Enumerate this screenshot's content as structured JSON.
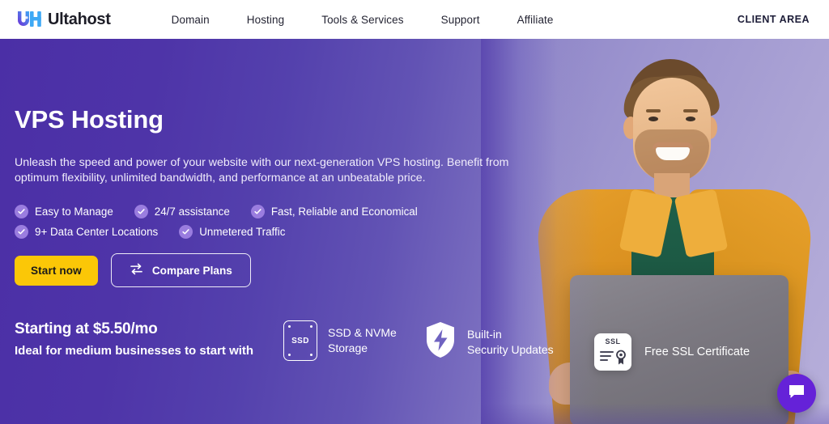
{
  "header": {
    "brand": {
      "name": "Ultahost",
      "logo_icon": "ultahost-uh-logo-icon"
    },
    "nav": [
      {
        "label": "Domain"
      },
      {
        "label": "Hosting"
      },
      {
        "label": "Tools & Services"
      },
      {
        "label": "Support"
      },
      {
        "label": "Affiliate"
      }
    ],
    "client_area": "CLIENT AREA"
  },
  "hero": {
    "title": "VPS Hosting",
    "subtitle": "Unleash the speed and power of your website with our next-generation VPS hosting. Benefit from optimum flexibility, unlimited bandwidth, and performance at an unbeatable price.",
    "features_row1": [
      {
        "label": "Easy to Manage",
        "icon": "check-circle-icon"
      },
      {
        "label": "24/7 assistance",
        "icon": "check-circle-icon"
      },
      {
        "label": "Fast, Reliable and Economical",
        "icon": "check-circle-icon"
      }
    ],
    "features_row2": [
      {
        "label": "9+ Data Center Locations",
        "icon": "check-circle-icon"
      },
      {
        "label": "Unmetered Traffic",
        "icon": "check-circle-icon"
      }
    ],
    "cta_primary": "Start now",
    "cta_secondary": "Compare Plans",
    "cta_secondary_icon": "compare-swap-arrows-icon"
  },
  "strip": {
    "price_headline": "Starting at $5.50/mo",
    "price_sub": "Ideal for medium businesses to start with",
    "perks": [
      {
        "label": "SSD & NVMe\nStorage",
        "icon": "ssd-drive-icon",
        "icon_text": "SSD"
      },
      {
        "label": "Built-in\nSecurity Updates",
        "icon": "shield-bolt-icon"
      }
    ],
    "ssl_badge": {
      "label": "Free SSL Certificate",
      "icon": "ssl-certificate-icon",
      "icon_text": "SSL"
    }
  },
  "widgets": {
    "chat": {
      "icon": "chat-bubble-icon",
      "color": "#6522d8"
    }
  },
  "colors": {
    "gradient_start": "#4b2fa6",
    "gradient_end": "#b8b0da",
    "accent_yellow": "#fbc707",
    "check_circle": "#9a7ddf",
    "brand_purple": "#6522d8",
    "text_dark": "#1d1d27"
  }
}
